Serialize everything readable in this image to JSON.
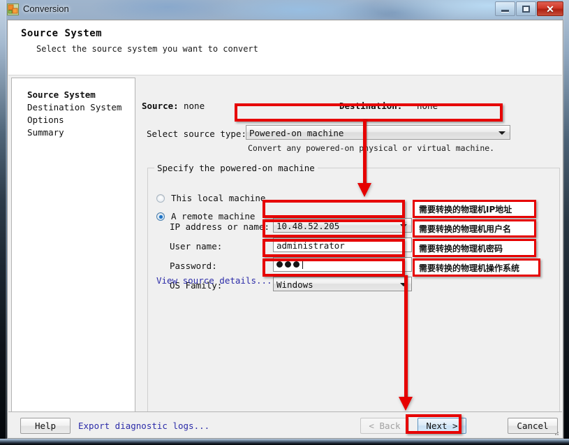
{
  "window": {
    "title": "Conversion",
    "icon": "vmware-converter-icon",
    "controls": {
      "minimize": "minimize-icon",
      "maximize": "maximize-icon",
      "close": "✕"
    }
  },
  "header": {
    "title": "Source System",
    "subtitle": "Select the source system you want to convert"
  },
  "sidebar": {
    "items": [
      {
        "label": "Source System",
        "active": true
      },
      {
        "label": "Destination System",
        "active": false
      },
      {
        "label": "Options",
        "active": false
      },
      {
        "label": "Summary",
        "active": false
      }
    ]
  },
  "main": {
    "source_label": "Source:",
    "source_value": "none",
    "destination_label": "Destination:",
    "destination_value": "none",
    "source_type_label": "Select source type:",
    "source_type_value": "Powered-on machine",
    "source_type_hint": "Convert any powered-on physical or virtual machine.",
    "group_title": "Specify the powered-on machine",
    "radios": [
      {
        "label": "This local machine",
        "checked": false
      },
      {
        "label": "A remote machine",
        "checked": true
      }
    ],
    "fields": [
      {
        "label": "IP address or name:",
        "value": "10.48.52.205",
        "type": "combo"
      },
      {
        "label": "User name:",
        "value": "administrator",
        "type": "text"
      },
      {
        "label": "Password:",
        "value": "•••",
        "type": "password",
        "dots": 3
      },
      {
        "label": "OS Family:",
        "value": "Windows",
        "type": "combo"
      }
    ],
    "view_details_link": "View source details..."
  },
  "footer": {
    "help": "Help",
    "export_logs": "Export diagnostic logs...",
    "back": "< Back",
    "next": "Next >",
    "cancel": "Cancel"
  },
  "annotations": {
    "color": "#e60000",
    "callouts": [
      "需要转换的物理机IP地址",
      "需要转换的物理机用户名",
      "需要转换的物理机密码",
      "需要转换的物理机操作系统"
    ],
    "highlighted_controls": [
      "source-type-combo",
      "ip-address-field",
      "user-name-field",
      "password-field",
      "os-family-combo",
      "next-button"
    ]
  }
}
